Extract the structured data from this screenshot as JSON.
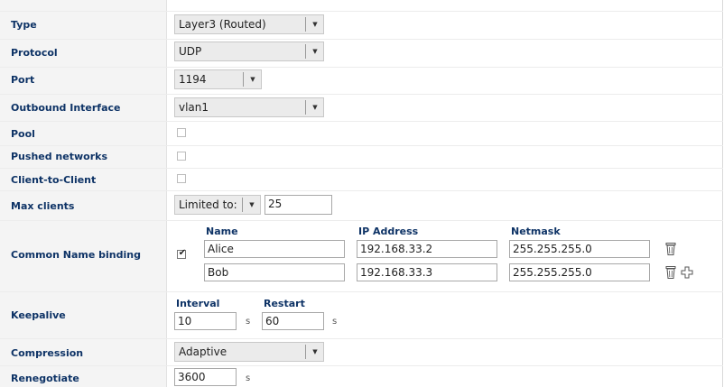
{
  "rows": {
    "type": {
      "label": "Type",
      "value": "Layer3 (Routed)"
    },
    "protocol": {
      "label": "Protocol",
      "value": "UDP"
    },
    "port": {
      "label": "Port",
      "value": "1194"
    },
    "outbound": {
      "label": "Outbound Interface",
      "value": "vlan1"
    },
    "pool": {
      "label": "Pool"
    },
    "pushed": {
      "label": "Pushed networks"
    },
    "c2c": {
      "label": "Client-to-Client"
    },
    "maxclients": {
      "label": "Max clients",
      "mode": "Limited to:",
      "value": "25"
    },
    "cnbinding": {
      "label": "Common Name binding",
      "headers": {
        "name": "Name",
        "ip": "IP Address",
        "netmask": "Netmask"
      },
      "entries": [
        {
          "name": "Alice",
          "ip": "192.168.33.2",
          "netmask": "255.255.255.0"
        },
        {
          "name": "Bob",
          "ip": "192.168.33.3",
          "netmask": "255.255.255.0"
        }
      ]
    },
    "keepalive": {
      "label": "Keepalive",
      "interval_label": "Interval",
      "interval_value": "10",
      "restart_label": "Restart",
      "restart_value": "60",
      "unit": "s"
    },
    "compression": {
      "label": "Compression",
      "value": "Adaptive"
    },
    "renegotiate": {
      "label": "Renegotiate",
      "value": "3600",
      "unit": "s"
    }
  },
  "glyphs": {
    "arrow": "▼",
    "check": "✔"
  },
  "icons": {
    "delete": "trash-icon",
    "add": "plus-icon"
  },
  "colors": {
    "label_text": "#0e3366",
    "label_bg": "#f4f4f4"
  }
}
